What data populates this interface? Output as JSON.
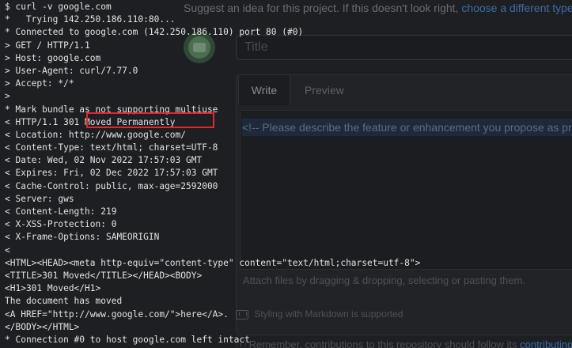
{
  "background_form": {
    "suggest_text": "Suggest an idea for this project. If this doesn't look right,",
    "suggest_link": "choose a different type",
    "title_placeholder": "Title",
    "tabs": [
      "Write",
      "Preview"
    ],
    "comment_placeholder": "<!-- Please describe the feature or enhancement you propose as prese",
    "attach_hint": "Attach files by dragging & dropping, selecting or pasting them.",
    "markdown_note": "Styling with Markdown is supported",
    "remember_text": "Remember, contributions to this repository should follow its",
    "remember_link": "contributing guide"
  },
  "terminal": {
    "lines": [
      "$ curl -v google.com",
      "*   Trying 142.250.186.110:80...",
      "* Connected to google.com (142.250.186.110) port 80 (#0)",
      "> GET / HTTP/1.1",
      "> Host: google.com",
      "> User-Agent: curl/7.77.0",
      "> Accept: */*",
      ">",
      "* Mark bundle as not supporting multiuse",
      "< HTTP/1.1 301 Moved Permanently",
      "< Location: http://www.google.com/",
      "< Content-Type: text/html; charset=UTF-8",
      "< Date: Wed, 02 Nov 2022 17:57:03 GMT",
      "< Expires: Fri, 02 Dec 2022 17:57:03 GMT",
      "< Cache-Control: public, max-age=2592000",
      "< Server: gws",
      "< Content-Length: 219",
      "< X-XSS-Protection: 0",
      "< X-Frame-Options: SAMEORIGIN",
      "<",
      "<HTML><HEAD><meta http-equiv=\"content-type\" content=\"text/html;charset=utf-8\">",
      "<TITLE>301 Moved</TITLE></HEAD><BODY>",
      "<H1>301 Moved</H1>",
      "The document has moved",
      "<A HREF=\"http://www.google.com/\">here</A>.",
      "</BODY></HTML>",
      "* Connection #0 to host google.com left intact"
    ],
    "highlighted_text": "Moved Permanently",
    "highlight_color": "#e0262e",
    "text_color": "#e3e3e3"
  }
}
